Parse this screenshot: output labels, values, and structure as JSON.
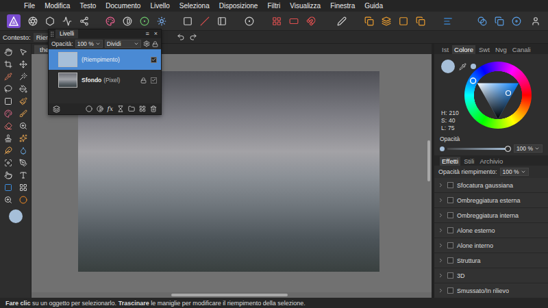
{
  "menu": [
    "File",
    "Modifica",
    "Testo",
    "Documento",
    "Livello",
    "Seleziona",
    "Disposizione",
    "Filtri",
    "Visualizza",
    "Finestra",
    "Guida"
  ],
  "context_bar": {
    "label": "Contesto:",
    "value": "Riempim"
  },
  "document_tab": {
    "label": "the-or"
  },
  "layers_panel": {
    "title": "Livelli",
    "controls": [
      "≡",
      "×"
    ],
    "opacity_label": "Opacità:",
    "opacity": "100 %",
    "blend_mode": "Dividi",
    "fx_button": "fx",
    "layers": [
      {
        "name": "(Riempimento)",
        "kind": "fill",
        "selected": true,
        "locked": false,
        "visible": true
      },
      {
        "name": "Sfondo",
        "type": "(Pixel)",
        "kind": "pixel",
        "selected": false,
        "locked": true,
        "visible": true
      }
    ]
  },
  "right_panel": {
    "tabs": [
      {
        "label": "Ist",
        "selected": false
      },
      {
        "label": "Colore",
        "selected": true
      },
      {
        "label": "Swt",
        "selected": false
      },
      {
        "label": "Nvg",
        "selected": false
      },
      {
        "label": "Canali",
        "selected": false
      }
    ],
    "color": {
      "values": [
        {
          "label": "H:",
          "value": "210"
        },
        {
          "label": "S:",
          "value": "40"
        },
        {
          "label": "L:",
          "value": "75"
        }
      ],
      "opacity_label": "Opacità",
      "opacity": "100 %",
      "opacity_level": 1
    },
    "effects_tabs": [
      {
        "label": "Effetti",
        "selected": true
      },
      {
        "label": "Stili",
        "selected": false
      },
      {
        "label": "Archivio",
        "selected": false
      }
    ],
    "fill_opacity_label": "Opacità riempimento:",
    "fill_opacity": "100 %",
    "effects": [
      {
        "name": "Sfocatura gaussiana",
        "checked": false
      },
      {
        "name": "Ombreggiatura esterna",
        "checked": false
      },
      {
        "name": "Ombreggiatura interna",
        "checked": false
      },
      {
        "name": "Alone esterno",
        "checked": false
      },
      {
        "name": "Alone interno",
        "checked": false
      },
      {
        "name": "Struttura",
        "checked": false
      },
      {
        "name": "3D",
        "checked": false
      },
      {
        "name": "Smussato/In rilievo",
        "checked": false
      }
    ]
  },
  "status_bar": {
    "parts": [
      {
        "text": "Fare clic",
        "bold": true
      },
      {
        "text": " su un oggetto per selezionarlo. ",
        "bold": false
      },
      {
        "text": "Trascinare",
        "bold": true
      },
      {
        "text": " le maniglie per modificare il riempimento della selezione.",
        "bold": false
      }
    ]
  }
}
